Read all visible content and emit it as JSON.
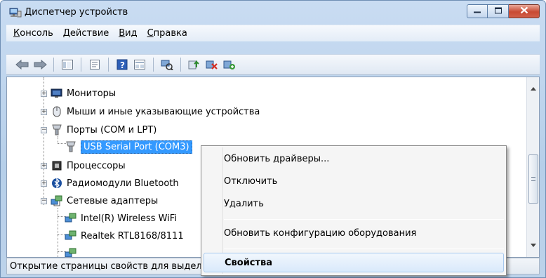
{
  "window": {
    "title": "Диспетчер устройств",
    "colors": {
      "selection": "#3399ff",
      "close_button": "#c84a33",
      "frame": "#b6cfe9"
    }
  },
  "menu": [
    "Консоль",
    "Действие",
    "Вид",
    "Справка"
  ],
  "toolbar": {
    "icons": [
      "back-arrow-icon",
      "forward-arrow-icon",
      "show-hide-tree-icon",
      "properties-icon",
      "help-icon",
      "view-icon",
      "scan-hardware-icon",
      "update-driver-icon",
      "disable-device-icon",
      "uninstall-device-icon"
    ]
  },
  "tree": {
    "items": [
      {
        "label": "Мониторы",
        "icon": "monitor-icon",
        "expander": "+"
      },
      {
        "label": "Мыши и иные указывающие устройства",
        "icon": "mouse-icon",
        "expander": "+"
      },
      {
        "label": "Порты (COM и LPT)",
        "icon": "port-icon",
        "expander": "−"
      },
      {
        "label": "USB Serial Port (COM3)",
        "icon": "port-icon",
        "selected": true
      },
      {
        "label": "Процессоры",
        "icon": "processor-icon",
        "expander": "+"
      },
      {
        "label": "Радиомодули Bluetooth",
        "icon": "bluetooth-icon",
        "expander": "+"
      },
      {
        "label": "Сетевые адаптеры",
        "icon": "network-adapter-icon",
        "expander": "−"
      },
      {
        "label": "Intel(R) Wireless WiFi",
        "icon": "network-adapter-icon"
      },
      {
        "label": "Realtek RTL8168/8111",
        "icon": "network-adapter-icon"
      },
      {
        "label": "",
        "icon": "network-adapter-icon"
      }
    ]
  },
  "context_menu": {
    "items": [
      "Обновить драйверы...",
      "Отключить",
      "Удалить",
      "Обновить конфигурацию оборудования",
      "Свойства"
    ]
  },
  "status": "Открытие страницы свойств для выделенного объекта."
}
